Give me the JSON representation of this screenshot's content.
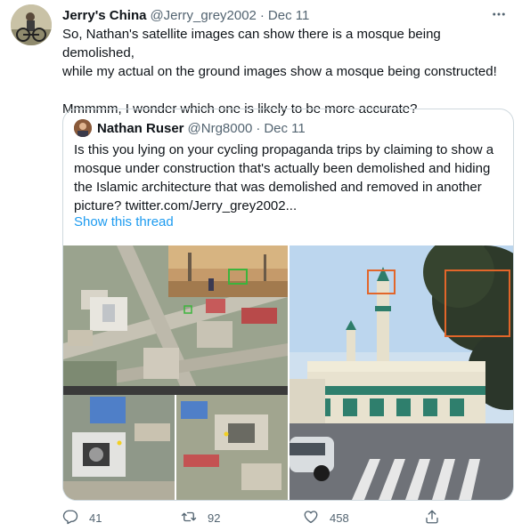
{
  "tweet": {
    "author_name": "Jerry's China",
    "author_handle": "@Jerry_grey2002",
    "separator": "·",
    "date": "Dec 11",
    "text_line1": "So, Nathan's satellite images can show there is a mosque being demolished,",
    "text_line2": "while my actual on the ground images show a mosque being constructed!",
    "text_line3": "Mmmmm, I wonder which one is likely to be more accurate?"
  },
  "quote": {
    "author_name": "Nathan Ruser",
    "author_handle": "@Nrg8000",
    "separator": "·",
    "date": "Dec 11",
    "text_line1": "Is this you lying on your cycling propaganda trips by claiming to show a",
    "text_line2": "mosque under construction that's actually been demolished and hiding",
    "text_line3": "the Islamic architecture that was demolished and removed in another",
    "text_line4_prefix": "picture?  ",
    "text_line4_link": "twitter.com/Jerry_grey2002...",
    "show_thread": "Show this thread"
  },
  "actions": {
    "reply_count": "41",
    "retweet_count": "92",
    "like_count": "458"
  },
  "icons": {
    "more": "more-icon",
    "reply": "reply-icon",
    "retweet": "retweet-icon",
    "like": "like-icon",
    "share": "share-icon"
  },
  "colors": {
    "link_blue": "#1d9bf0",
    "secondary_text": "#536471",
    "border": "#cfd9de",
    "annotation_orange": "#e2662a"
  }
}
